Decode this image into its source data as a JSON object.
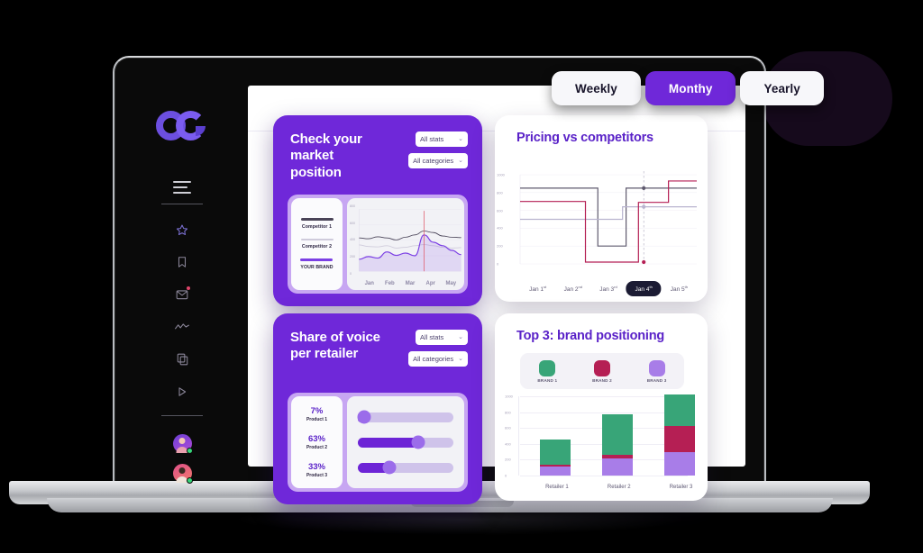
{
  "brand": {
    "logo_name": "analytics-logo"
  },
  "sidebar": {
    "menu_label": "menu",
    "nav": [
      {
        "icon": "star-icon",
        "name": "favorites"
      },
      {
        "icon": "bookmark-icon",
        "name": "bookmarks"
      },
      {
        "icon": "mail-badge-icon",
        "name": "messages"
      },
      {
        "icon": "trend-line-icon",
        "name": "analytics"
      },
      {
        "icon": "copy-icon",
        "name": "documents"
      },
      {
        "icon": "play-icon",
        "name": "media"
      }
    ],
    "avatars": [
      {
        "name": "avatar-user-1",
        "status": "online"
      },
      {
        "name": "avatar-user-2",
        "status": "online"
      }
    ]
  },
  "period_toggle": {
    "options": [
      {
        "label": "Weekly",
        "active": false
      },
      {
        "label": "Monthy",
        "active": true
      },
      {
        "label": "Yearly",
        "active": false
      }
    ]
  },
  "cards": {
    "market": {
      "title": "Check your market\nposition",
      "select_stats": "All stats",
      "select_categories": "All categories",
      "chevron": "⌄",
      "legend": [
        {
          "label": "Competitor 1",
          "color": "#4a4458"
        },
        {
          "label": "Competitor 2",
          "color": "#cfcbdb"
        },
        {
          "label": "YOUR BRAND",
          "color": "#7b3fe4"
        }
      ]
    },
    "voice": {
      "title": "Share of voice\nper retailer",
      "select_stats": "All stats",
      "select_categories": "All categories",
      "chevron": "⌄",
      "rows": [
        {
          "pct": "7%",
          "product": "Product 1",
          "value": 7
        },
        {
          "pct": "63%",
          "product": "Product 2",
          "value": 63
        },
        {
          "pct": "33%",
          "product": "Product 3",
          "value": 33
        }
      ]
    },
    "pricing": {
      "title": "Pricing vs competitors"
    },
    "top3": {
      "title": "Top 3: brand positioning",
      "brands": [
        {
          "label": "BRAND 1",
          "color": "#38a578"
        },
        {
          "label": "BRAND 2",
          "color": "#b51f54"
        },
        {
          "label": "BRAND 3",
          "color": "#a87de8"
        }
      ]
    }
  },
  "chart_data": [
    {
      "id": "market-position",
      "type": "area",
      "title": "Check your market position",
      "xlabel": "",
      "ylabel": "",
      "categories": [
        "Jan",
        "Feb",
        "Mar",
        "Apr",
        "May"
      ],
      "x_ticks": [
        "Jan",
        "Feb",
        "Mar",
        "Apr",
        "May"
      ],
      "y_ticks": [
        "800",
        "600",
        "400",
        "200",
        "0"
      ],
      "ylim": [
        0,
        800
      ],
      "grid": true,
      "legend_position": "left",
      "marker_line_x": "Apr",
      "marker_color": "#e05a6a",
      "series": [
        {
          "name": "Competitor 1",
          "color": "#4a4458",
          "values": [
            430,
            420,
            445,
            430,
            405,
            440,
            470,
            520,
            500,
            455,
            440,
            435
          ]
        },
        {
          "name": "Competitor 2",
          "color": "#cfcbdb",
          "values": [
            340,
            320,
            315,
            330,
            300,
            310,
            330,
            345,
            330,
            310,
            300,
            305
          ]
        },
        {
          "name": "YOUR BRAND",
          "color": "#7b3fe4",
          "filled": true,
          "values": [
            155,
            190,
            170,
            250,
            205,
            235,
            200,
            470,
            375,
            330,
            270,
            215
          ]
        }
      ]
    },
    {
      "id": "pricing-vs-competitors",
      "type": "line",
      "title": "Pricing vs competitors",
      "xlabel": "",
      "ylabel": "",
      "x_ticks": [
        "Jan 1st",
        "Jan 2nd",
        "Jan 3rd",
        "Jan 4th",
        "Jan 5th"
      ],
      "y_ticks": [
        "1000",
        "800",
        "600",
        "400",
        "200",
        "0"
      ],
      "ylim": [
        0,
        1000
      ],
      "grid": true,
      "step": true,
      "highlighted_tick": "Jan 4th",
      "cursor_x": "Jan 4th",
      "series": [
        {
          "name": "Competitor dark",
          "color": "#5f5a6e",
          "points": [
            [
              0,
              850
            ],
            [
              2.2,
              850
            ],
            [
              2.2,
              200
            ],
            [
              3.0,
              200
            ],
            [
              3.0,
              850
            ],
            [
              5,
              850
            ]
          ]
        },
        {
          "name": "Competitor light",
          "color": "#b9b4cf",
          "points": [
            [
              0,
              500
            ],
            [
              2.9,
              500
            ],
            [
              2.9,
              640
            ],
            [
              5,
              640
            ]
          ]
        },
        {
          "name": "Your brand",
          "color": "#b51f54",
          "points": [
            [
              0,
              700
            ],
            [
              1.85,
              700
            ],
            [
              1.85,
              20
            ],
            [
              3.35,
              20
            ],
            [
              3.35,
              690
            ],
            [
              4.2,
              690
            ],
            [
              4.2,
              930
            ],
            [
              5,
              930
            ]
          ]
        }
      ],
      "markers": [
        {
          "x": "Jan 4th",
          "y": 850,
          "color": "#5f5a6e"
        },
        {
          "x": "Jan 4th",
          "y": 640,
          "color": "#b9b4cf"
        },
        {
          "x": "Jan 4th",
          "y": 20,
          "color": "#b51f54"
        }
      ]
    },
    {
      "id": "share-of-voice",
      "type": "bar",
      "title": "Share of voice per retailer",
      "orientation": "horizontal",
      "categories": [
        "Product 1",
        "Product 2",
        "Product 3"
      ],
      "values": [
        7,
        63,
        33
      ],
      "value_labels": [
        "7%",
        "63%",
        "33%"
      ],
      "xlim": [
        0,
        100
      ],
      "track_color": "#cfc3ea",
      "fill_color": "#6d24d6",
      "knob_color": "#9b6cea"
    },
    {
      "id": "brand-positioning",
      "type": "bar",
      "stacked": true,
      "title": "Top 3: brand positioning",
      "xlabel": "",
      "ylabel": "",
      "categories": [
        "Retailer 1",
        "Retailer 2",
        "Retailer 3"
      ],
      "y_ticks": [
        "1000",
        "800",
        "600",
        "400",
        "200",
        "0"
      ],
      "ylim": [
        0,
        1000
      ],
      "grid": true,
      "legend_position": "top",
      "series": [
        {
          "name": "BRAND 3",
          "color": "#a87de8",
          "values": [
            110,
            215,
            290
          ]
        },
        {
          "name": "BRAND 2",
          "color": "#b51f54",
          "values": [
            30,
            45,
            330
          ]
        },
        {
          "name": "BRAND 1",
          "color": "#38a578",
          "values": [
            320,
            510,
            400
          ]
        }
      ]
    }
  ]
}
